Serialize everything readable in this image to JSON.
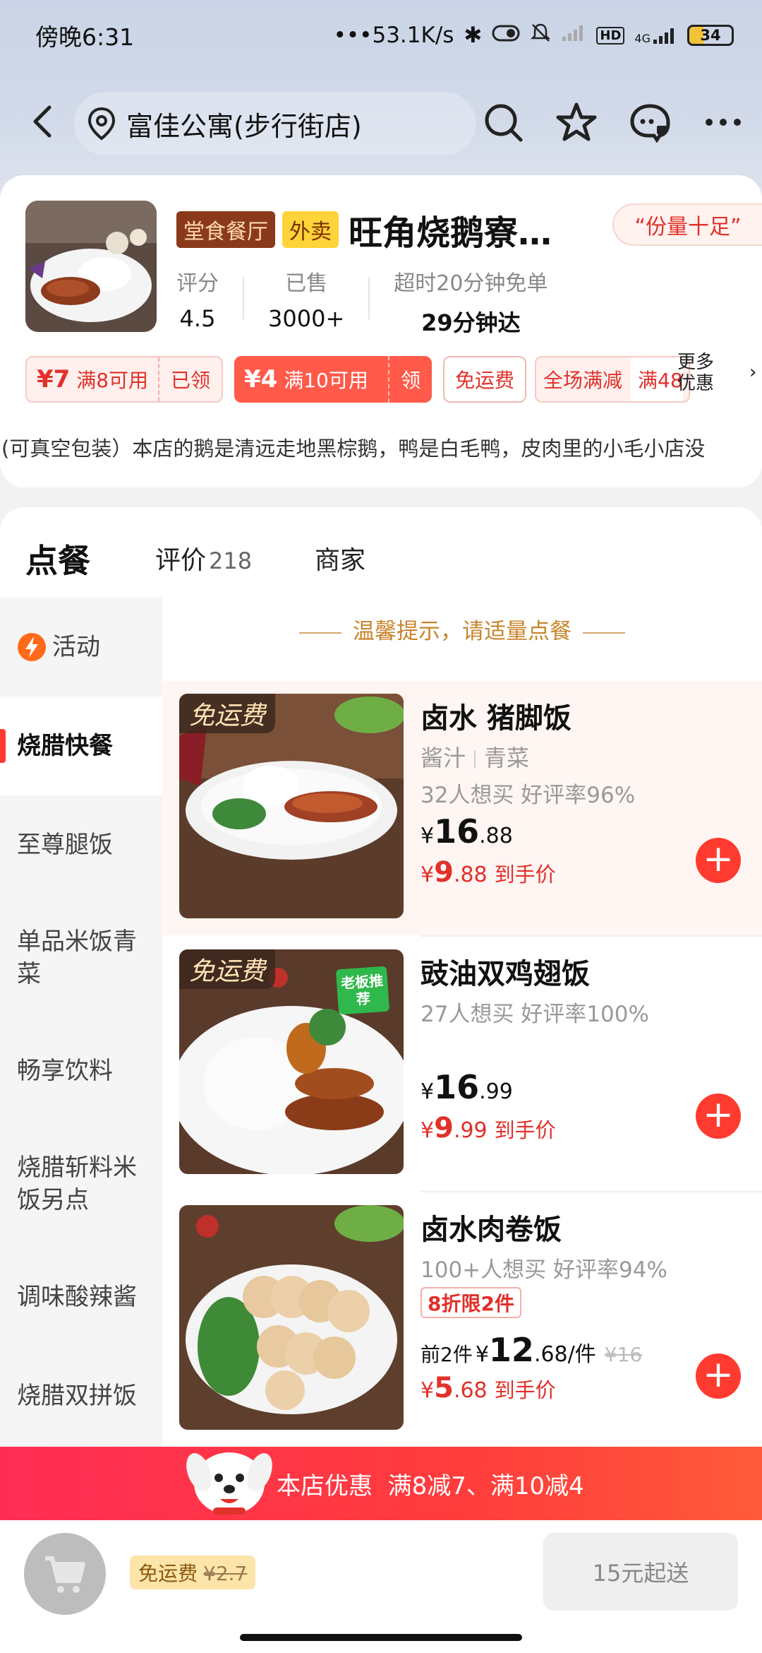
{
  "status": {
    "time": "傍晚6:31",
    "speed": "•••53.1K/s",
    "network": "4G",
    "battery": "34"
  },
  "nav": {
    "location": "富佳公寓(步行街店)"
  },
  "shop": {
    "tag_dine": "堂食餐厅",
    "tag_takeout": "外卖",
    "name": "旺角烧鹅寮…",
    "slogan": "“份量十足”",
    "rating_label": "评分",
    "rating": "4.5",
    "sold_label": "已售",
    "sold": "3000+",
    "delivery_label": "超时20分钟免单",
    "delivery": "29分钟达",
    "intro": "(可真空包装）本店的鹅是清远走地黑棕鹅，鸭是白毛鸭，皮肉里的小毛小店没"
  },
  "coupons": [
    {
      "amount": "¥7",
      "cond": "满8可用",
      "action": "已领"
    },
    {
      "amount": "¥4",
      "cond": "满10可用",
      "action": "领"
    },
    {
      "text": "免运费"
    },
    {
      "text": "全场满减",
      "extra": "满48"
    }
  ],
  "more_offers": {
    "line1": "更多",
    "line2": "优惠"
  },
  "tabs": [
    {
      "label": "点餐"
    },
    {
      "label": "评价",
      "count": "218"
    },
    {
      "label": "商家"
    }
  ],
  "sidebar": [
    {
      "label": "活动"
    },
    {
      "label": "烧腊快餐"
    },
    {
      "label": "至尊腿饭"
    },
    {
      "label": "单品米饭青菜"
    },
    {
      "label": "畅享饮料"
    },
    {
      "label": "烧腊斩料米饭另点"
    },
    {
      "label": "调味酸辣酱"
    },
    {
      "label": "烧腊双拼饭"
    }
  ],
  "tip": "温馨提示，请适量点餐",
  "dishes": [
    {
      "badge": "免运费",
      "name": "卤水 猪脚饭",
      "sub1": "酱汁",
      "sub2": "青菜",
      "social": "32人想买  好评率96%",
      "price_int": "16",
      "price_dec": ".88",
      "final_int": "9",
      "final_dec": ".88",
      "final_label": "到手价"
    },
    {
      "badge": "免运费",
      "boss": "老板推荐",
      "name": "豉油双鸡翅饭",
      "social": "27人想买  好评率100%",
      "price_int": "16",
      "price_dec": ".99",
      "final_int": "9",
      "final_dec": ".99",
      "final_label": "到手价"
    },
    {
      "name": "卤水肉卷饭",
      "social": "100+人想买  好评率94%",
      "promo": "8折限2件",
      "price_prefix": "前2件",
      "price_int": "12",
      "price_dec": ".68",
      "price_unit": "/件",
      "original": "¥16",
      "final_int": "5",
      "final_dec": ".68",
      "final_label": "到手价"
    }
  ],
  "banner": "本店优惠  满8减7、满10减4",
  "bottom": {
    "free_label": "免运费",
    "free_old": "¥2.7",
    "min_order": "15元起送"
  }
}
